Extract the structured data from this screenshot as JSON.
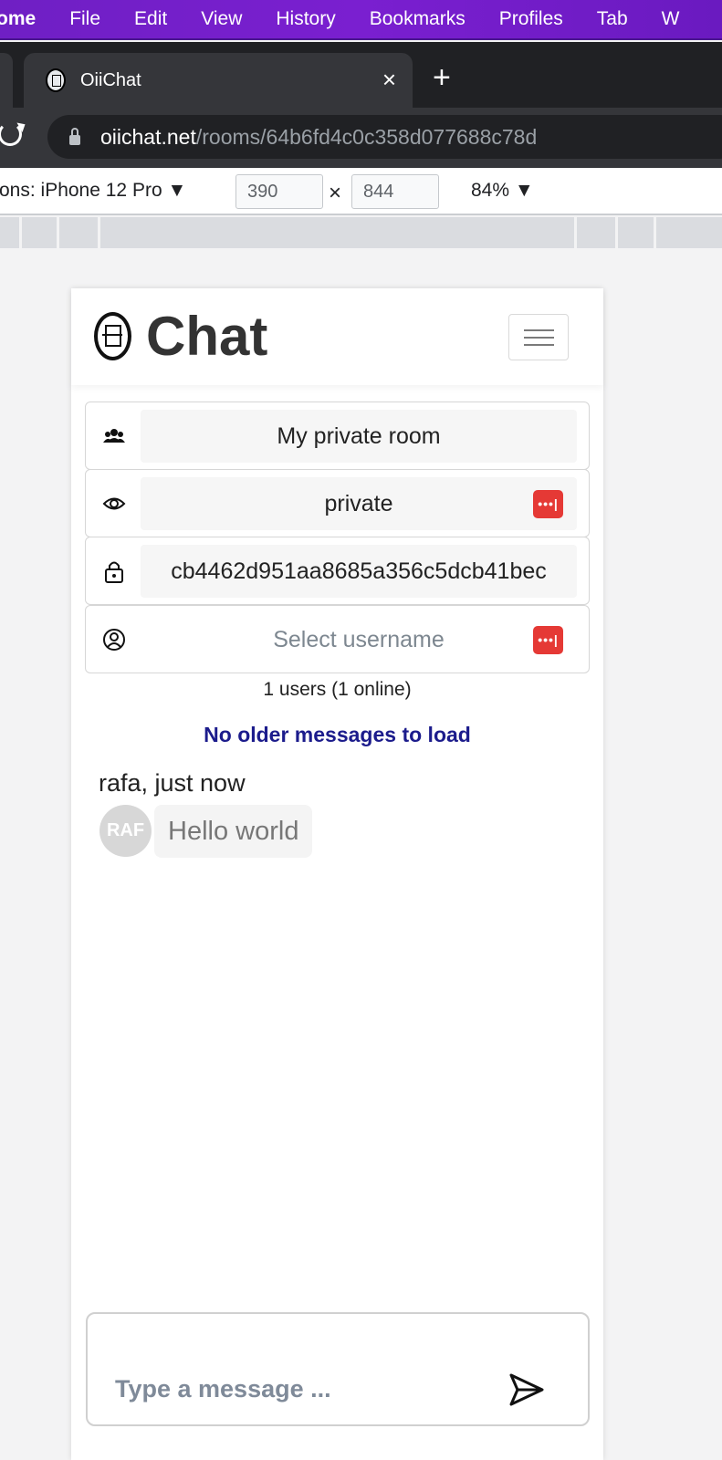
{
  "menubar": {
    "app": "ome",
    "items": [
      "File",
      "Edit",
      "View",
      "History",
      "Bookmarks",
      "Profiles",
      "Tab",
      "W"
    ]
  },
  "browser": {
    "tab_title": "OiiChat",
    "close_glyph": "×",
    "new_tab_glyph": "+",
    "url_host": "oiichat.net",
    "url_path": "/rooms/64b6fd4c0c358d077688c78d"
  },
  "devtools": {
    "device_label": "ons: iPhone 12 Pro ▼",
    "width": "390",
    "times": "×",
    "height": "844",
    "zoom": "84% ▼"
  },
  "app": {
    "brand": "Chat",
    "room_name": "My private room",
    "visibility": "private",
    "room_key": "cb4462d951aa8685a356c5dcb41bec",
    "username_placeholder": "Select username",
    "password_button": "•••|",
    "users_stats": "1 users (1 online)",
    "older_messages": "No older messages to load",
    "messages": [
      {
        "header": "rafa, just now",
        "avatar": "RAF",
        "text": "Hello world"
      }
    ],
    "composer_placeholder": "Type a message ..."
  },
  "colors": {
    "menubar": "#7a1fd0",
    "accent_red": "#e53935",
    "older_link": "#1c1c8c"
  }
}
